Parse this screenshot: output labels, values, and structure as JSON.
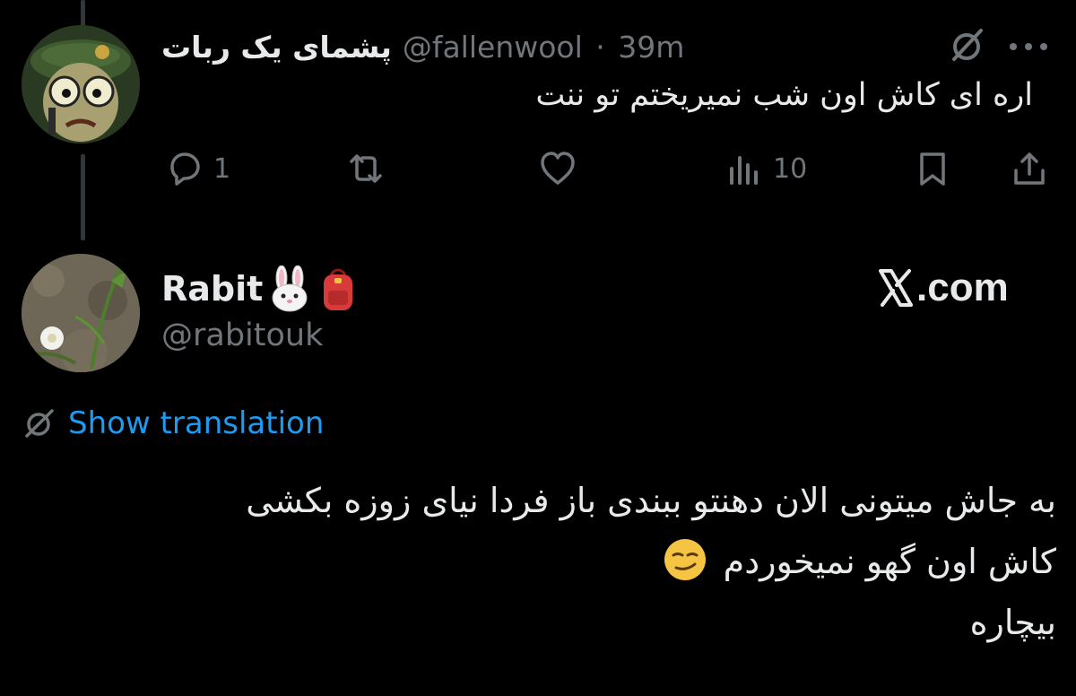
{
  "tweet1": {
    "display_name": "پشمای یک ربات",
    "handle": "@fallenwool",
    "separator": "·",
    "time": "39m",
    "text": "اره ای کاش اون شب نمیریختم تو ننت",
    "avatar_icon": "cartoon-soldier-avatar",
    "actions": {
      "reply_count": "1",
      "retweet_count": "",
      "like_count": "",
      "views_count": "10"
    }
  },
  "tweet2": {
    "display_name": "Rabit",
    "name_emojis": [
      "rabbit-face-emoji",
      "backpack-emoji"
    ],
    "handle": "@rabitouk",
    "avatar_icon": "flower-photo-avatar",
    "watermark": "𝕏.com",
    "watermark_text": ".com",
    "show_translation": "Show translation",
    "body_lines": [
      "به جاش میتونی الان دهنتو ببندی باز فردا نیای زوزه بکشی",
      "کاش اون گهو نمیخوردم",
      "بیچاره"
    ],
    "smirk_emoji": "smirking-face-emoji"
  },
  "colors": {
    "background": "#000000",
    "primary_text": "#e7e9ea",
    "secondary_text": "#71767b",
    "link_blue": "#1d9bf0",
    "thread_line": "#333639"
  }
}
